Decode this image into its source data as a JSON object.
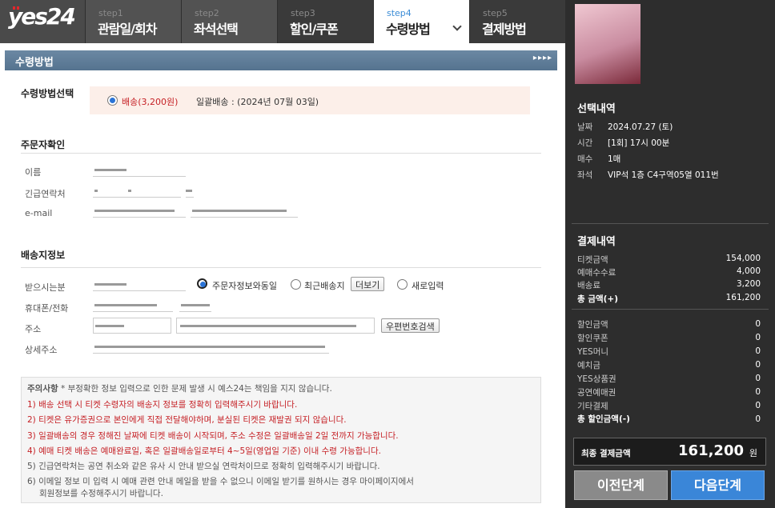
{
  "brand": {
    "logo": "yes24"
  },
  "steps": [
    {
      "num": "step1",
      "label": "관람일/회차"
    },
    {
      "num": "step2",
      "label": "좌석선택"
    },
    {
      "num": "step3",
      "label": "할인/쿠폰"
    },
    {
      "num": "step4",
      "label": "수령방법"
    },
    {
      "num": "step5",
      "label": "결제방법"
    }
  ],
  "section_title": "수령방법",
  "section_arrows": "▸▸▸▸",
  "receipt": {
    "heading": "수령방법선택",
    "option_label": "배송(3,200원)",
    "option_selected": true,
    "bulk_delivery": "일괄배송 : (2024년 07월 03일)"
  },
  "orderer": {
    "heading": "주문자확인",
    "name_label": "이름",
    "phone_label": "긴급연락처",
    "email_label": "e-mail"
  },
  "shipping": {
    "heading": "배송지정보",
    "recipient_label": "받으시는분",
    "opt_same": "주문자정보와동일",
    "opt_recent": "최근배송지",
    "more_button": "더보기",
    "opt_new": "새로입력",
    "phone_label": "휴대폰/전화",
    "address_label": "주소",
    "zip_button": "우편번호검색",
    "detail_label": "상세주소"
  },
  "notice": {
    "title": "주의사항",
    "subtitle": "* 부정확한 정보 입력으로 인한 문제 발생 시 예스24는 책임을 지지 않습니다.",
    "items": [
      "1) 배송 선택 시 티켓 수령자의 배송지 정보를 정확히 입력해주시기 바랍니다.",
      "2) 티켓은 유가증권으로 본인에게 직접 전달해야하며, 분실된 티켓은 재발권 되지 않습니다.",
      "3) 일괄배송의 경우 정해진 날짜에 티켓 배송이 시작되며, 주소 수정은 일괄배송일 2일 전까지 가능합니다.",
      "4) 예매 티켓 배송은 예매완료일, 혹은 일괄배송일로부터 4~5일(영업일 기준) 이내 수령 가능합니다.",
      "5) 긴급연락처는 공연 취소와 같은 유사 시 안내 받으실 연락처이므로 정확히 입력해주시기 바랍니다.",
      "6) 이메일 정보 미 입력 시 예매 관련 안내 메일을 받을 수 없으니 이메일 받기를 원하시는 경우 마이페이지에서",
      "회원정보를 수정해주시기 바랍니다."
    ]
  },
  "selection": {
    "heading": "선택내역",
    "date_label": "날짜",
    "date": "2024.07.27 (토)",
    "time_label": "시간",
    "time": "[1회] 17시 00분",
    "count_label": "매수",
    "count": "1매",
    "seat_label": "좌석",
    "seat": "VIP석 1층 C4구역05열 011번"
  },
  "payment": {
    "heading": "결제내역",
    "rows": [
      {
        "label": "티켓금액",
        "value": "154,000"
      },
      {
        "label": "예매수수료",
        "value": "4,000"
      },
      {
        "label": "배송료",
        "value": "3,200"
      },
      {
        "label": "총 금액(+)",
        "value": "161,200"
      }
    ],
    "discounts": [
      {
        "label": "할인금액",
        "value": "0"
      },
      {
        "label": "할인쿠폰",
        "value": "0"
      },
      {
        "label": "YES머니",
        "value": "0"
      },
      {
        "label": "예치금",
        "value": "0"
      },
      {
        "label": "YES상품권",
        "value": "0"
      },
      {
        "label": "공연예매권",
        "value": "0"
      },
      {
        "label": "기타결제",
        "value": "0"
      },
      {
        "label": "총 할인금액(-)",
        "value": "0"
      }
    ],
    "final_label": "최종 결제금액",
    "final_amount": "161,200",
    "final_unit": "원"
  },
  "buttons": {
    "prev": "이전단계",
    "next": "다음단계"
  },
  "colors": {
    "accent": "#3a86d8",
    "warning": "#c51f24",
    "header": "#3a3a3a",
    "section": "#5f7d98"
  }
}
